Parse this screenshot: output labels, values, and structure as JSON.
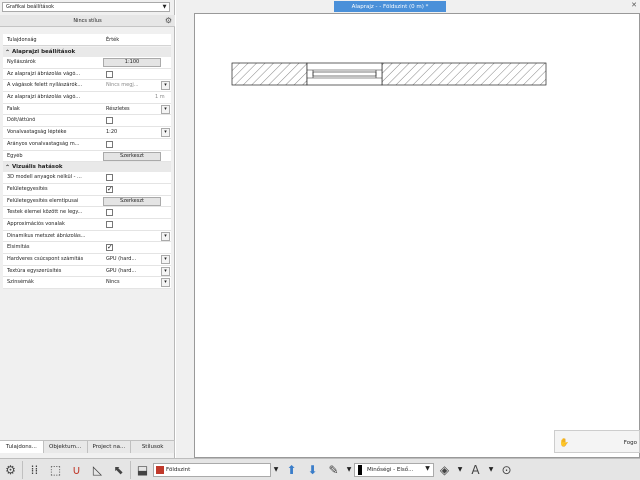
{
  "left_panel": {
    "view_select": "Grafikai beállítások",
    "panel_title": "Nincs stílus",
    "header": {
      "property": "Tulajdonság",
      "value": "Érték"
    },
    "sections": [
      {
        "title": "Alaprajzi beállítások",
        "rows": [
          {
            "label": "Nyilászárók",
            "type": "button",
            "value": "1:100"
          },
          {
            "label": "Az alaprajzi ábrázolás vágó...",
            "type": "checkbox",
            "checked": false
          },
          {
            "label": "A vágások felett nyílászárók...",
            "type": "dropdown-disabled",
            "value": "Nincs megj..."
          },
          {
            "label": "Az alaprajzi ábrázolás vágó...",
            "type": "unit-disabled",
            "value": "",
            "unit": "1 m"
          },
          {
            "label": "Falak",
            "type": "dropdown",
            "value": "Részletes"
          },
          {
            "label": "Dőlt/áttűnő",
            "type": "checkbox",
            "checked": false
          },
          {
            "label": "Vonalvastagság léptéke",
            "type": "dropdown",
            "value": "1:20"
          },
          {
            "label": "Arányos vonalvastagság m...",
            "type": "checkbox",
            "checked": false
          },
          {
            "label": "Egyéb",
            "type": "button",
            "value": "Szerkeszt"
          }
        ]
      },
      {
        "title": "Vizuális hatások",
        "rows": [
          {
            "label": "3D modell anyagok nélkül - ...",
            "type": "checkbox",
            "checked": false
          },
          {
            "label": "Felületegyesítés",
            "type": "checkbox",
            "checked": true
          },
          {
            "label": "Felületegyesítés elemtípusai",
            "type": "button",
            "value": "Szerkeszt"
          },
          {
            "label": "Testek élemei között ne legy...",
            "type": "checkbox",
            "checked": false
          },
          {
            "label": "Approximációs vonalak",
            "type": "checkbox",
            "checked": false
          },
          {
            "label": "Dinamikus metszet ábrázolás...",
            "type": "dropdown",
            "value": ""
          },
          {
            "label": "Élsimítás",
            "type": "checkbox",
            "checked": true
          },
          {
            "label": "Hardveres csúcspont számítás",
            "type": "dropdown",
            "value": "GPU (hard..."
          },
          {
            "label": "Textúra egyszerűsítés",
            "type": "dropdown",
            "value": "GPU (hard..."
          },
          {
            "label": "Színsémák",
            "type": "dropdown",
            "value": "Nincs"
          }
        ]
      }
    ],
    "tabs": [
      "Tulajdons...",
      "Objektum...",
      "Project na...",
      "Stílusok"
    ]
  },
  "document": {
    "tab_title": "Alaprajz - - Földszint (0 m) *",
    "close_glyph": "✕"
  },
  "notification": {
    "text": "Fogo"
  },
  "bottom_bar": {
    "story": "Földszint",
    "pen": "Minőségi - Első..."
  },
  "colors": {
    "accent_tab": "#4a90d9",
    "panel_bg": "#f0f0f0"
  }
}
